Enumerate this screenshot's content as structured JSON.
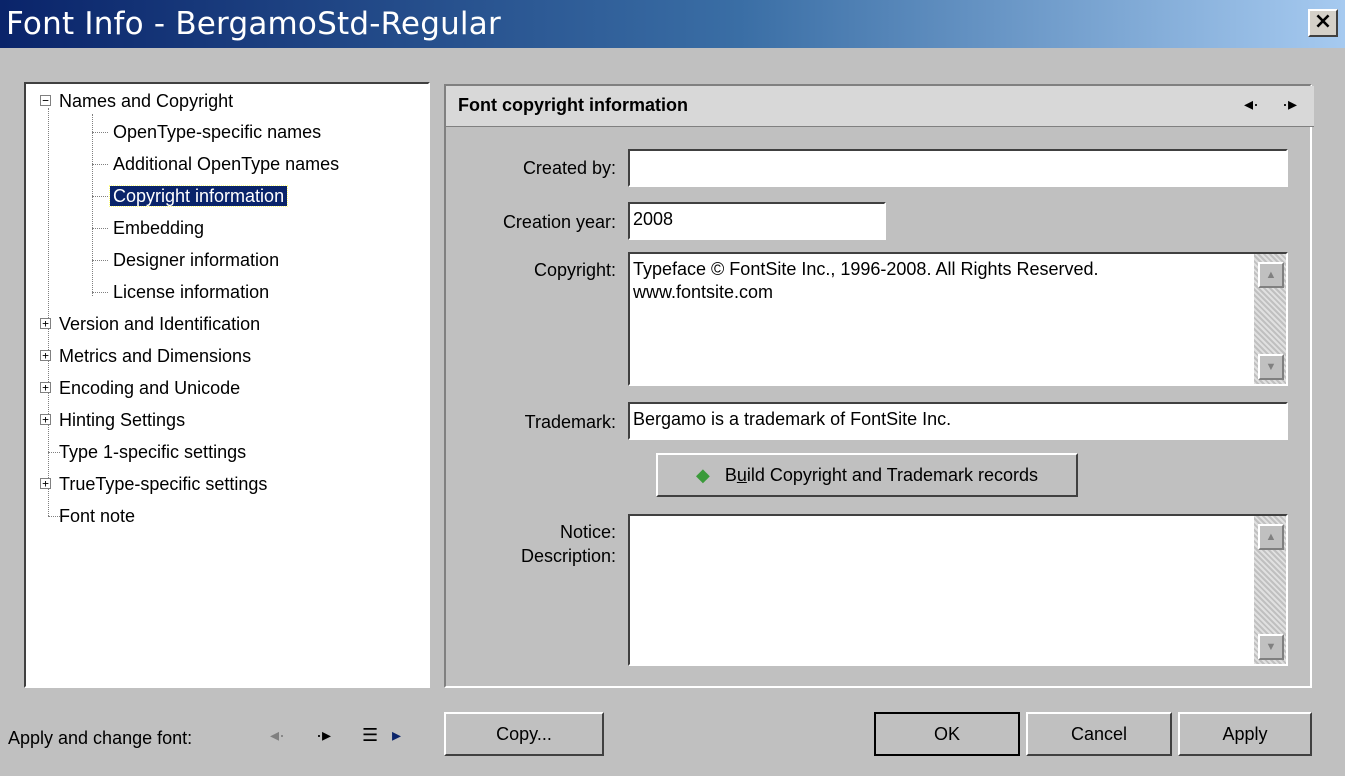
{
  "window": {
    "title": "Font Info - BergamoStd-Regular",
    "close_glyph": "×"
  },
  "tree": {
    "items": [
      {
        "label": "Names and Copyright",
        "expander": "−"
      },
      {
        "label": "OpenType-specific names"
      },
      {
        "label": "Additional OpenType names"
      },
      {
        "label": "Copyright information"
      },
      {
        "label": "Embedding"
      },
      {
        "label": "Designer information"
      },
      {
        "label": "License information"
      },
      {
        "label": "Version and Identification",
        "expander": "+"
      },
      {
        "label": "Metrics and Dimensions",
        "expander": "+"
      },
      {
        "label": "Encoding and Unicode",
        "expander": "+"
      },
      {
        "label": "Hinting Settings",
        "expander": "+"
      },
      {
        "label": "Type 1-specific settings"
      },
      {
        "label": "TrueType-specific settings",
        "expander": "+"
      },
      {
        "label": "Font note"
      }
    ],
    "selected": "Copyright information"
  },
  "panel": {
    "title": "Font copyright information",
    "prev_icon": "◂·",
    "next_icon": "·▸",
    "created_by_label": "Created by:",
    "created_by_value": "",
    "creation_year_label": "Creation year:",
    "creation_year_value": "2008",
    "copyright_label": "Copyright:",
    "copyright_line1": "Typeface © FontSite Inc., 1996-2008. All Rights Reserved.",
    "copyright_line2": "www.fontsite.com",
    "trademark_label": "Trademark:",
    "trademark_value": "Bergamo is a trademark of FontSite Inc.",
    "build_icon": "◆",
    "build_button_pre": "B",
    "build_button_u": "u",
    "build_button_post": "ild Copyright and Trademark records",
    "notice_label_1": "Notice:",
    "notice_label_2": "Description:",
    "notice_value": ""
  },
  "footer": {
    "apply_change_label": "Apply and change font:",
    "prev_font_icon": "◂·",
    "next_font_icon": "·▸",
    "list_icon": "☰",
    "menu_arrow_icon": "▸",
    "copy_button": "Copy...",
    "ok_button": "OK",
    "cancel_button": "Cancel",
    "apply_button": "Apply"
  },
  "colors": {
    "titlebar_start": "#0a246a",
    "selection": "#0a246a",
    "dialog_bg": "#c0c0c0"
  }
}
